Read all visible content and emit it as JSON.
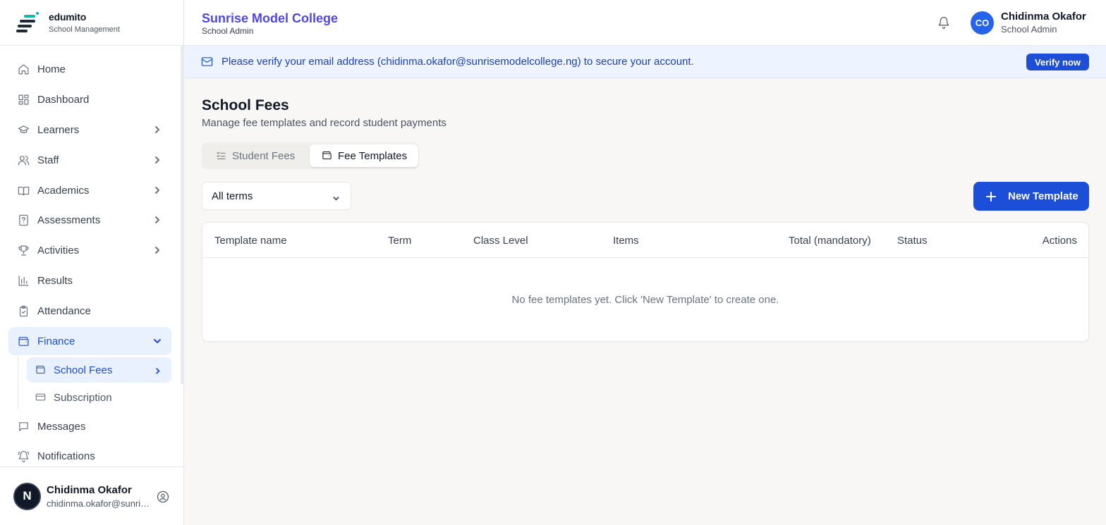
{
  "brand": {
    "name": "edumito",
    "subtitle": "School Management"
  },
  "sidebar": {
    "items": [
      {
        "label": "Home",
        "icon": "home-icon"
      },
      {
        "label": "Dashboard",
        "icon": "dashboard-icon"
      },
      {
        "label": "Learners",
        "icon": "graduation-cap-icon"
      },
      {
        "label": "Staff",
        "icon": "users-icon"
      },
      {
        "label": "Academics",
        "icon": "book-icon"
      },
      {
        "label": "Assessments",
        "icon": "question-file-icon"
      },
      {
        "label": "Activities",
        "icon": "trophy-icon"
      },
      {
        "label": "Results",
        "icon": "bar-chart-icon"
      },
      {
        "label": "Attendance",
        "icon": "clipboard-check-icon"
      },
      {
        "label": "Finance",
        "icon": "wallet-icon"
      },
      {
        "label": "Messages",
        "icon": "message-icon"
      },
      {
        "label": "Notifications",
        "icon": "bell-ring-icon"
      }
    ],
    "finance_sub": [
      {
        "label": "School Fees",
        "icon": "wallet-icon"
      },
      {
        "label": "Subscription",
        "icon": "credit-card-icon"
      }
    ],
    "user": {
      "initial": "N",
      "name": "Chidinma Okafor",
      "email": "chidinma.okafor@sunrisemodelcollege.ng"
    }
  },
  "header": {
    "school_name": "Sunrise Model College",
    "role": "School Admin",
    "user_initials": "CO",
    "user_name": "Chidinma Okafor",
    "user_role": "School Admin"
  },
  "banner": {
    "message": "Please verify your email address (chidinma.okafor@sunrisemodelcollege.ng) to secure your account.",
    "button": "Verify now"
  },
  "main": {
    "title": "School Fees",
    "subtitle": "Manage fee templates and record student payments",
    "tabs": [
      {
        "label": "Student Fees",
        "icon": "list-check-icon"
      },
      {
        "label": "Fee Templates",
        "icon": "wallet-icon"
      }
    ],
    "term_filter": "All terms",
    "new_button": "New Template",
    "table": {
      "columns": [
        "Template name",
        "Term",
        "Class Level",
        "Items",
        "Total (mandatory)",
        "Status",
        "Actions"
      ],
      "empty_message": "No fee templates yet. Click 'New Template' to create one."
    }
  },
  "colors": {
    "primary": "#1d4ed8",
    "school_name": "#4f46e5",
    "active_bg": "#eaf1fe",
    "banner_bg": "#eef4ff"
  }
}
